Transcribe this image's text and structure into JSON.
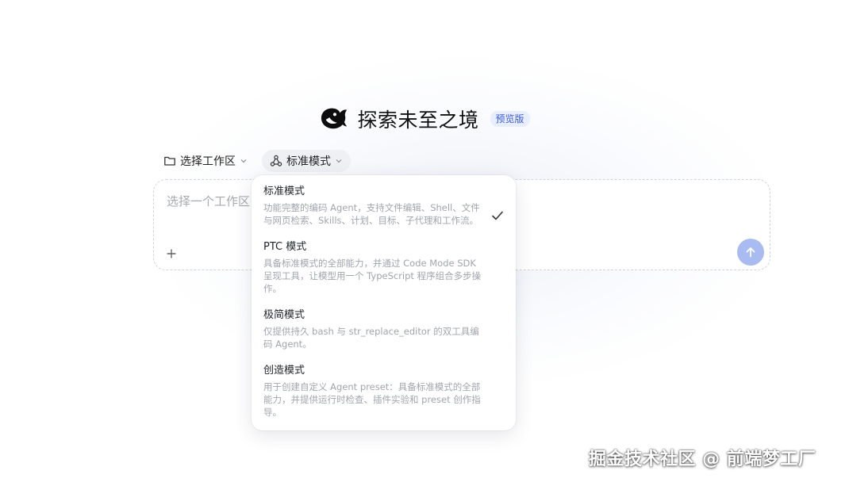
{
  "hero": {
    "title": "探索未至之境",
    "badge": "预览版"
  },
  "toolbar": {
    "workspace_label": "选择工作区",
    "mode_label": "标准模式"
  },
  "composer": {
    "placeholder": "选择一个工作区"
  },
  "mode_menu": {
    "options": [
      {
        "title": "标准模式",
        "desc": "功能完整的编码 Agent，支持文件编辑、Shell、文件与网页检索、Skills、计划、目标、子代理和工作流。",
        "selected": true
      },
      {
        "title": "PTC 模式",
        "desc": "具备标准模式的全部能力，并通过 Code Mode SDK 呈现工具，让模型用一个 TypeScript 程序组合多步操作。",
        "selected": false
      },
      {
        "title": "极简模式",
        "desc": "仅提供持久 bash 与 str_replace_editor 的双工具编码 Agent。",
        "selected": false
      },
      {
        "title": "创造模式",
        "desc": "用于创建自定义 Agent preset：具备标准模式的全部能力，并提供运行时检查、插件实验和 preset 创作指导。",
        "selected": false
      }
    ]
  },
  "watermark": "掘金技术社区 @ 前端梦工厂",
  "colors": {
    "accent": "#3b5bd6",
    "send_button": "#a8bcf2",
    "badge_bg": "#e9eefc"
  }
}
